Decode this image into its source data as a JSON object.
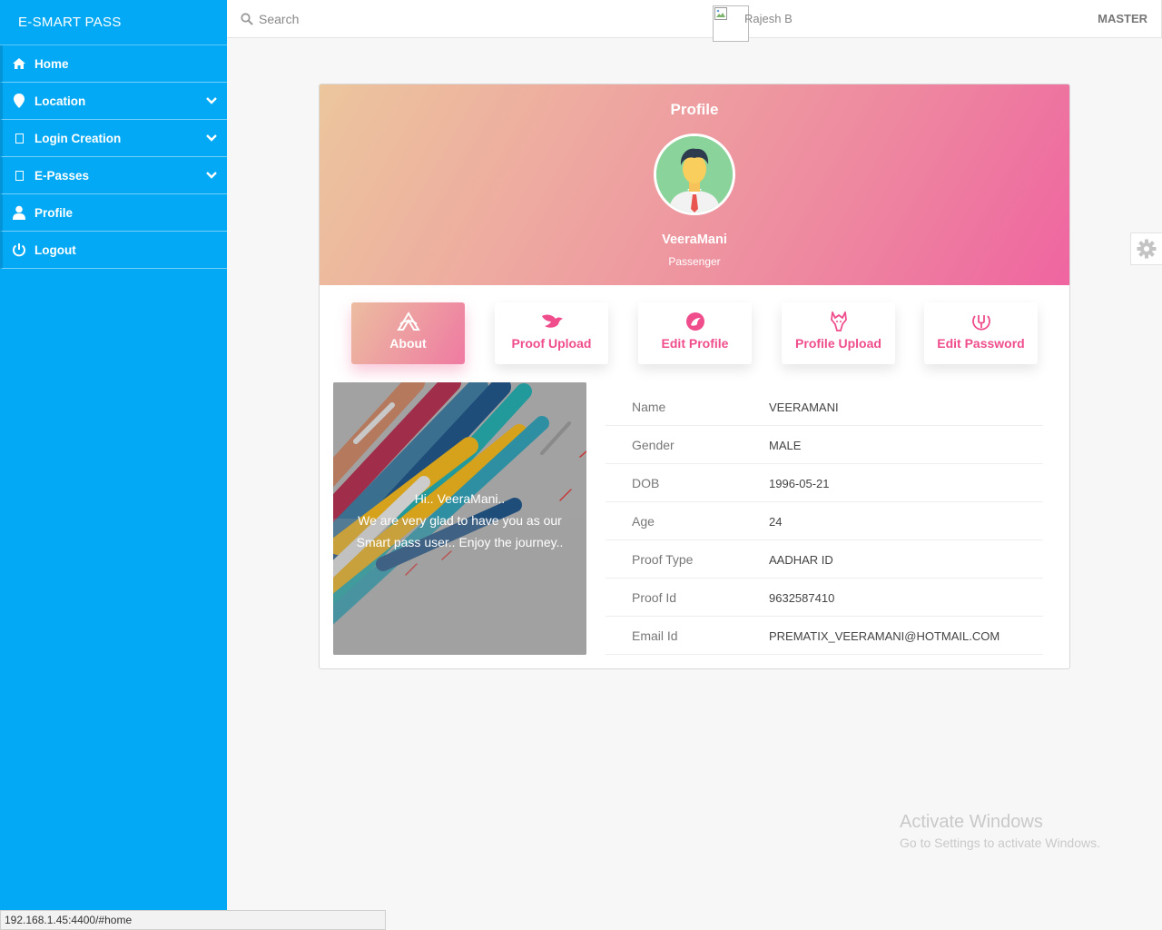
{
  "app": {
    "brand": "E-SMART PASS"
  },
  "sidebar": {
    "items": [
      {
        "label": "Home",
        "icon": "home-icon",
        "expandable": false
      },
      {
        "label": "Location",
        "icon": "map-pin-icon",
        "expandable": true
      },
      {
        "label": "Login Creation",
        "icon": "square-icon",
        "expandable": true
      },
      {
        "label": "E-Passes",
        "icon": "square-icon",
        "expandable": true
      },
      {
        "label": "Profile",
        "icon": "user-icon",
        "expandable": false
      },
      {
        "label": "Logout",
        "icon": "power-icon",
        "expandable": false
      }
    ]
  },
  "topbar": {
    "search_placeholder": "Search",
    "user_name": "Rajesh B",
    "role_label": "MASTER"
  },
  "profile": {
    "title": "Profile",
    "name": "VeeraMani",
    "role": "Passenger",
    "tabs": [
      {
        "label": "About",
        "icon": "about-icon",
        "active": true
      },
      {
        "label": "Proof Upload",
        "icon": "bird-icon",
        "active": false
      },
      {
        "label": "Edit Profile",
        "icon": "phoenix-icon",
        "active": false
      },
      {
        "label": "Profile Upload",
        "icon": "dragon-icon",
        "active": false
      },
      {
        "label": "Edit Password",
        "icon": "shield-icon",
        "active": false
      }
    ],
    "welcome_lines": [
      "Hi.. VeeraMani..",
      "We are very glad to have you as our",
      "Smart pass user.. Enjoy the journey.."
    ],
    "details": [
      {
        "label": "Name",
        "value": "VEERAMANI"
      },
      {
        "label": "Gender",
        "value": "MALE"
      },
      {
        "label": "DOB",
        "value": "1996-05-21"
      },
      {
        "label": "Age",
        "value": "24"
      },
      {
        "label": "Proof Type",
        "value": "AADHAR ID"
      },
      {
        "label": "Proof Id",
        "value": "9632587410"
      },
      {
        "label": "Email Id",
        "value": "PREMATIX_VEERAMANI@HOTMAIL.COM"
      }
    ]
  },
  "watermark": {
    "title": "Activate Windows",
    "subtitle": "Go to Settings to activate Windows."
  },
  "statusbar": {
    "url": "192.168.1.45:4400/#home"
  },
  "colors": {
    "sidebar": "#03a9f4",
    "accent": "#ef4d8c",
    "gradient_start": "#ecc69d",
    "gradient_end": "#ef65a0"
  }
}
